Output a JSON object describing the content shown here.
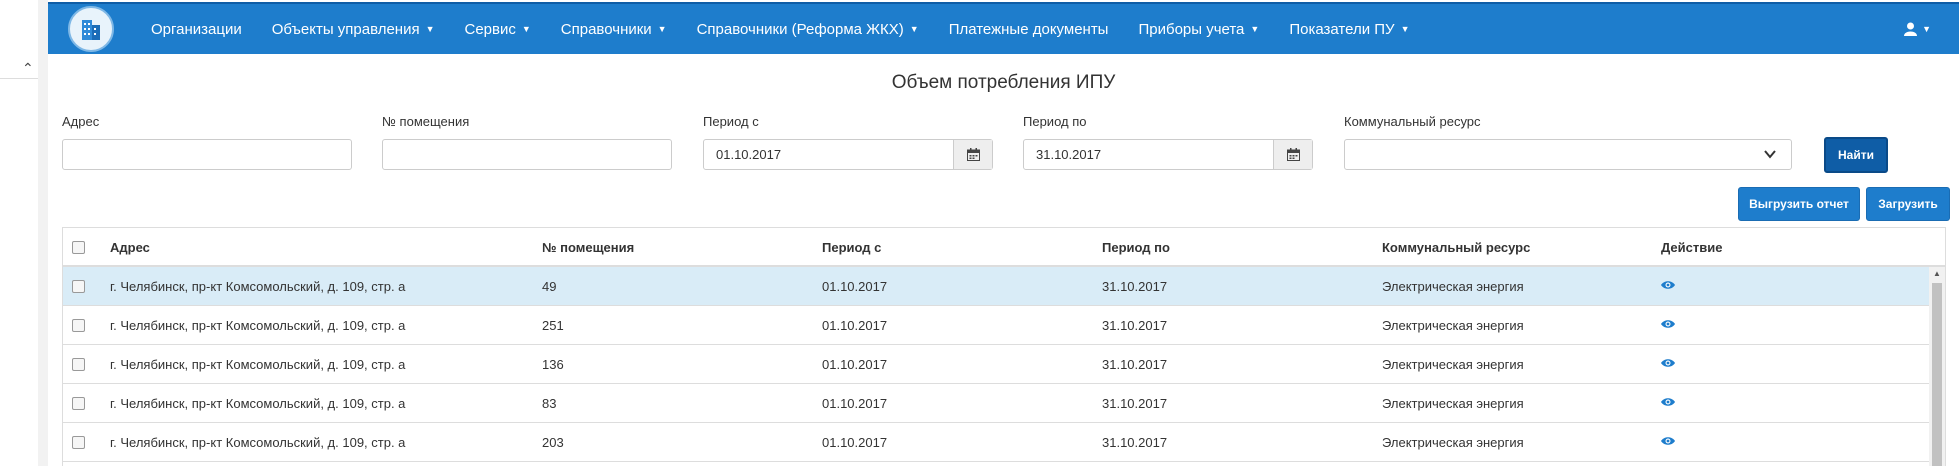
{
  "nav": {
    "items": [
      {
        "label": "Организации",
        "dropdown": false
      },
      {
        "label": "Объекты управления",
        "dropdown": true
      },
      {
        "label": "Сервис",
        "dropdown": true
      },
      {
        "label": "Справочники",
        "dropdown": true
      },
      {
        "label": "Справочники (Реформа ЖКХ)",
        "dropdown": true
      },
      {
        "label": "Платежные документы",
        "dropdown": false
      },
      {
        "label": "Приборы учета",
        "dropdown": true
      },
      {
        "label": "Показатели ПУ",
        "dropdown": true
      }
    ],
    "user_icon": "user-icon"
  },
  "page": {
    "title": "Объем потребления ИПУ"
  },
  "filters": {
    "address_label": "Адрес",
    "address_value": "",
    "room_label": "№ помещения",
    "room_value": "",
    "period_from_label": "Период с",
    "period_from_value": "01.10.2017",
    "period_to_label": "Период по",
    "period_to_value": "31.10.2017",
    "resource_label": "Коммунальный ресурс",
    "resource_value": ""
  },
  "buttons": {
    "find": "Найти",
    "export": "Выгрузить отчет",
    "upload": "Загрузить"
  },
  "table": {
    "headers": [
      "Адрес",
      "№ помещения",
      "Период с",
      "Период по",
      "Коммунальный ресурс",
      "Действие"
    ],
    "rows": [
      {
        "address": "г. Челябинск, пр-кт Комсомольский, д. 109, стр. а",
        "room": "49",
        "from": "01.10.2017",
        "to": "31.10.2017",
        "resource": "Электрическая энергия",
        "selected": true
      },
      {
        "address": "г. Челябинск, пр-кт Комсомольский, д. 109, стр. а",
        "room": "251",
        "from": "01.10.2017",
        "to": "31.10.2017",
        "resource": "Электрическая энергия",
        "selected": false
      },
      {
        "address": "г. Челябинск, пр-кт Комсомольский, д. 109, стр. а",
        "room": "136",
        "from": "01.10.2017",
        "to": "31.10.2017",
        "resource": "Электрическая энергия",
        "selected": false
      },
      {
        "address": "г. Челябинск, пр-кт Комсомольский, д. 109, стр. а",
        "room": "83",
        "from": "01.10.2017",
        "to": "31.10.2017",
        "resource": "Электрическая энергия",
        "selected": false
      },
      {
        "address": "г. Челябинск, пр-кт Комсомольский, д. 109, стр. а",
        "room": "203",
        "from": "01.10.2017",
        "to": "31.10.2017",
        "resource": "Электрическая энергия",
        "selected": false
      }
    ]
  },
  "colors": {
    "navbar": "#1e7dcc",
    "selected_row": "#d9ecf7",
    "button": "#1e7dcc"
  }
}
